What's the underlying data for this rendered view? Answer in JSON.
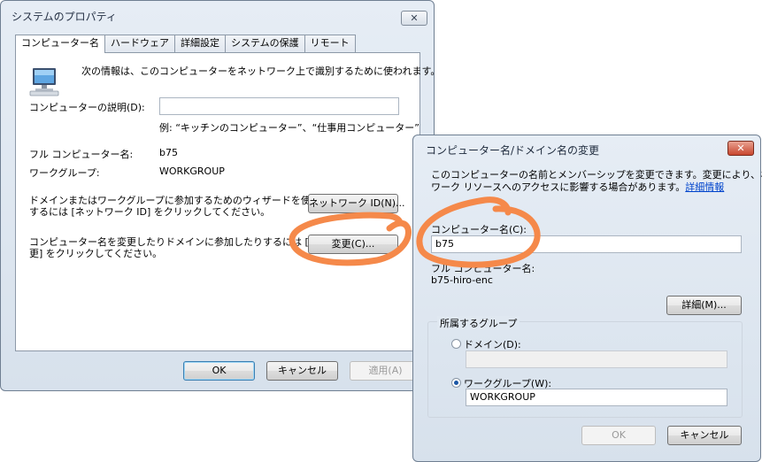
{
  "sysprop": {
    "title": "システムのプロパティ",
    "close_glyph": "✕",
    "tabs": [
      {
        "label": "コンピューター名"
      },
      {
        "label": "ハードウェア"
      },
      {
        "label": "詳細設定"
      },
      {
        "label": "システムの保護"
      },
      {
        "label": "リモート"
      }
    ],
    "intro": "次の情報は、このコンピューターをネットワーク上で識別するために使われます。",
    "description_label": "コンピューターの説明(D):",
    "description_value": "",
    "example": "例: “キッチンのコンピューター”、“仕事用コンピューター”",
    "fullname_label": "フル コンピューター名:",
    "fullname_value": "b75",
    "workgroup_label": "ワークグループ:",
    "workgroup_value": "WORKGROUP",
    "network_text_1": "ドメインまたはワークグループに参加するためのウィザードを使用",
    "network_text_2": "するには [ネットワーク ID] をクリックしてください。",
    "network_button": "ネットワーク ID(N)...",
    "change_text_1": "コンピューター名を変更したりドメインに参加したりするには [変",
    "change_text_2": "更] をクリックしてください。",
    "change_button": "変更(C)...",
    "ok": "OK",
    "cancel": "キャンセル",
    "apply": "適用(A)"
  },
  "rename": {
    "title": "コンピューター名/ドメイン名の変更",
    "close_glyph": "✕",
    "intro_1": "このコンピューターの名前とメンバーシップを変更できます。変更により、ネット",
    "intro_2": "ワーク リソースへのアクセスに影響する場合があります。",
    "details_link": "詳細情報",
    "name_label": "コンピューター名(C):",
    "name_value": "b75",
    "fullname_label": "フル コンピューター名:",
    "fullname_value": "b75-hiro-enc",
    "more_button": "詳細(M)...",
    "group_label": "所属するグループ",
    "domain_label": "ドメイン(D):",
    "domain_value": "",
    "workgroup_label": "ワークグループ(W):",
    "workgroup_value": "WORKGROUP",
    "ok": "OK",
    "cancel": "キャンセル"
  },
  "colors": {
    "annotation": "#f5894a",
    "link": "#0044cc"
  },
  "icons": [
    "computer-icon",
    "close-icon"
  ]
}
